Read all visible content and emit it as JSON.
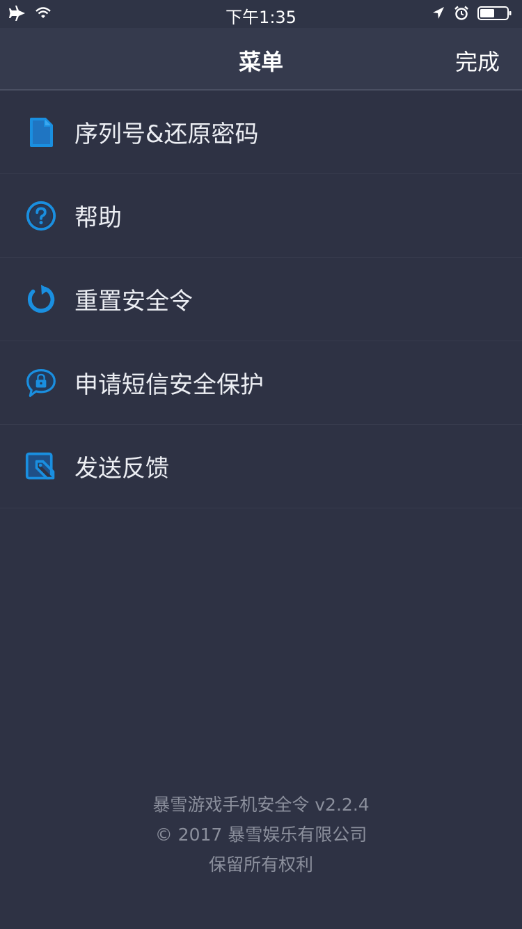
{
  "status_bar": {
    "time": "下午1:35",
    "icons": [
      "airplane-icon",
      "wifi-icon",
      "location-arrow-icon",
      "alarm-icon",
      "battery-icon"
    ]
  },
  "nav": {
    "title": "菜单",
    "done_label": "完成"
  },
  "menu": {
    "items": [
      {
        "label": "序列号&还原密码",
        "icon": "document-icon"
      },
      {
        "label": "帮助",
        "icon": "help-icon"
      },
      {
        "label": "重置安全令",
        "icon": "reset-icon"
      },
      {
        "label": "申请短信安全保护",
        "icon": "sms-lock-icon"
      },
      {
        "label": "发送反馈",
        "icon": "feedback-icon"
      }
    ]
  },
  "footer": {
    "line1": "暴雪游戏手机安全令 v2.2.4",
    "line2": "© 2017 暴雪娱乐有限公司",
    "line3": "保留所有权利"
  },
  "colors": {
    "background": "#2e3244",
    "nav_background": "#353a4d",
    "accent": "#1a8fe0",
    "footer_text": "#8b8f9c"
  }
}
